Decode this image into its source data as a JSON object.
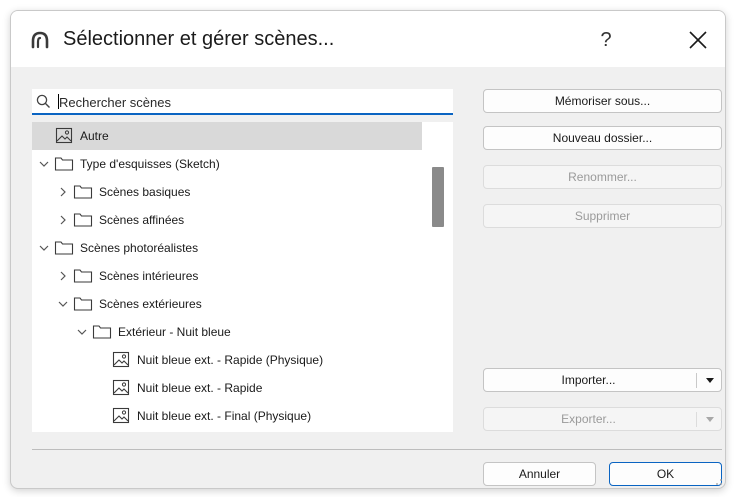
{
  "dialog": {
    "title": "Sélectionner et gérer scènes...",
    "help_label": "?"
  },
  "search": {
    "placeholder": "Rechercher scènes",
    "value": ""
  },
  "tree": {
    "items": [
      {
        "label": "Autre",
        "type": "scene",
        "selected": true
      },
      {
        "label": "Type d'esquisses (Sketch)",
        "type": "folder",
        "state": "expanded"
      },
      {
        "label": "Scènes basiques",
        "type": "folder",
        "state": "collapsed"
      },
      {
        "label": "Scènes affinées",
        "type": "folder",
        "state": "collapsed"
      },
      {
        "label": "Scènes photoréalistes",
        "type": "folder",
        "state": "expanded"
      },
      {
        "label": "Scènes intérieures",
        "type": "folder",
        "state": "collapsed"
      },
      {
        "label": "Scènes extérieures",
        "type": "folder",
        "state": "expanded"
      },
      {
        "label": "Extérieur - Nuit bleue",
        "type": "folder",
        "state": "expanded"
      },
      {
        "label": "Nuit bleue ext. - Rapide (Physique)",
        "type": "scene"
      },
      {
        "label": "Nuit bleue ext. - Rapide",
        "type": "scene"
      },
      {
        "label": "Nuit bleue ext. - Final (Physique)",
        "type": "scene"
      }
    ]
  },
  "actions": {
    "save_as": "Mémoriser sous...",
    "new_folder": "Nouveau dossier...",
    "rename": "Renommer...",
    "delete": "Supprimer",
    "import": "Importer...",
    "export": "Exporter..."
  },
  "footer": {
    "cancel": "Annuler",
    "ok": "OK"
  },
  "colors": {
    "accent": "#0a64c2",
    "selection": "#d9d9d9",
    "disabled_text": "#9a9a9a"
  }
}
